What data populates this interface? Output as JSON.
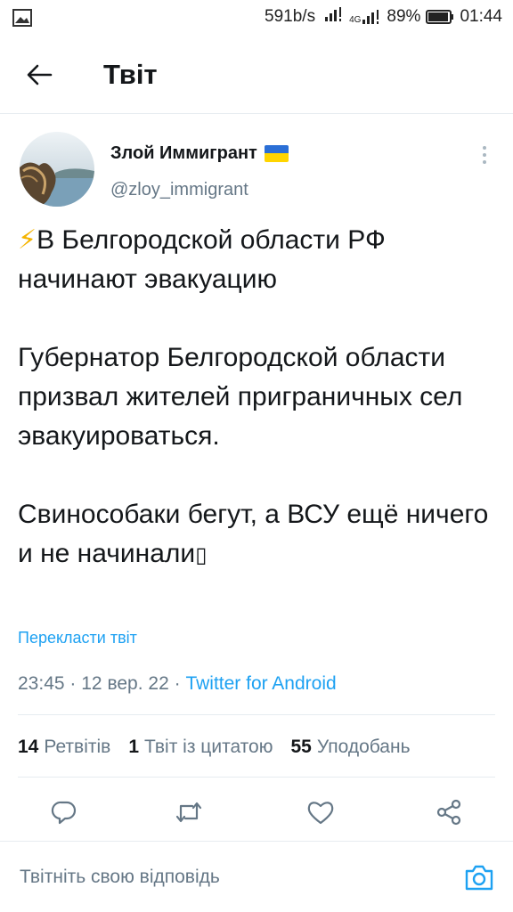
{
  "status_bar": {
    "network_speed": "591b/s",
    "network_type": "4G",
    "battery": "89%",
    "time": "01:44",
    "icons": [
      "gallery-icon",
      "signal-icon",
      "signal-4g-icon",
      "battery-icon"
    ]
  },
  "header": {
    "title": "Твіт",
    "back_icon": "arrow-left-icon"
  },
  "tweet": {
    "author_name": "Злой Иммигрант",
    "author_flag": "ukraine-flag",
    "handle": "@zloy_immigrant",
    "body": {
      "line1": "⚡",
      "line1_text": "В Белгородской области РФ начинают эвакуацию",
      "para2": "Губернатор Белгородской области призвал жителей приграничных сел эвакуироваться.",
      "para3": "Свиноcобаки бегут, а ВСУ ещё ничего и не начинали",
      "para3_tail_glyph": "▯"
    },
    "translate_link": "Перекласти твіт",
    "time": "23:45",
    "date": "12 вер. 22",
    "separator": "·",
    "source": "Twitter for Android"
  },
  "stats": {
    "retweets_count": "14",
    "retweets_label": "Ретвітів",
    "quotes_count": "1",
    "quotes_label": "Твіт із цитатою",
    "likes_count": "55",
    "likes_label": "Уподобань"
  },
  "actions": [
    "reply-icon",
    "retweet-icon",
    "like-icon",
    "share-icon"
  ],
  "reply_bar": {
    "placeholder": "Твітніть свою відповідь",
    "camera_icon": "camera-icon"
  },
  "colors": {
    "accent": "#1da1f2",
    "text": "#14171a",
    "secondary": "#657786",
    "divider": "#e6ecf0",
    "flag_blue": "#2b6fd6",
    "flag_yellow": "#ffd500"
  }
}
